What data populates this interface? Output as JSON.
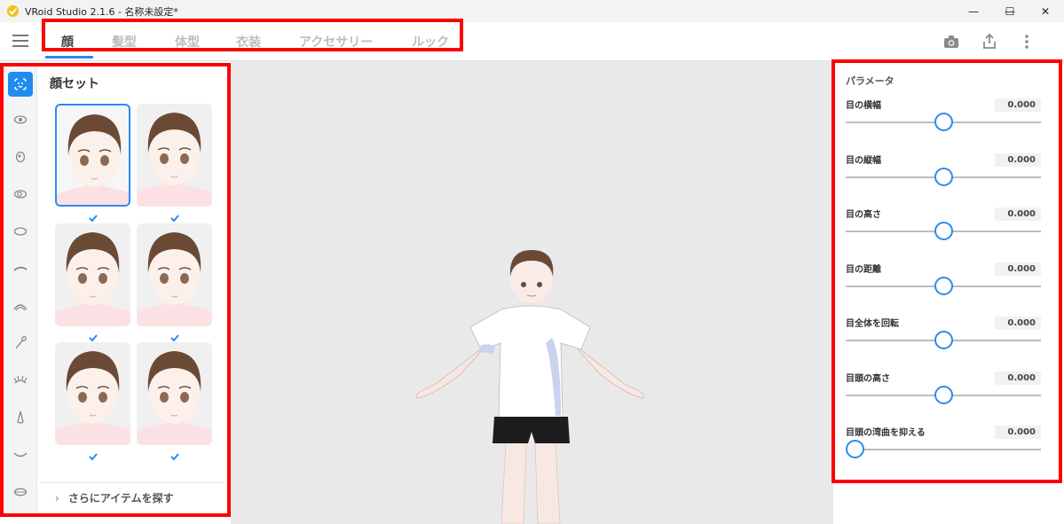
{
  "window": {
    "title": "VRoid Studio 2.1.6 - 名称未設定*",
    "controls": {
      "minimize": "—",
      "maximize": "☐",
      "close": "✕"
    }
  },
  "header": {
    "tabs": [
      {
        "label": "顔",
        "active": true
      },
      {
        "label": "髪型",
        "active": false
      },
      {
        "label": "体型",
        "active": false
      },
      {
        "label": "衣装",
        "active": false
      },
      {
        "label": "アクセサリー",
        "active": false
      },
      {
        "label": "ルック",
        "active": false
      }
    ],
    "icons": [
      "camera-icon",
      "share-icon",
      "more-vertical-icon"
    ]
  },
  "left_panel": {
    "rail_icons": [
      "face-icon",
      "eye-icon",
      "iris-icon",
      "eye-outline-icon",
      "eye-white-icon",
      "eyebrow-icon",
      "eyelid-icon",
      "eyeshadow-brush-icon",
      "eyelash-icon",
      "nose-icon",
      "mouth-icon",
      "ear-icon"
    ],
    "set_title": "顔セット",
    "items": [
      {
        "name": "face-1",
        "selected": true,
        "checked": true
      },
      {
        "name": "face-2",
        "selected": false,
        "checked": true
      },
      {
        "name": "face-3",
        "selected": false,
        "checked": true
      },
      {
        "name": "face-4",
        "selected": false,
        "checked": true
      },
      {
        "name": "face-5",
        "selected": false,
        "checked": true
      },
      {
        "name": "face-6",
        "selected": false,
        "checked": true
      }
    ],
    "more_label": "さらにアイテムを探す"
  },
  "right_panel": {
    "title": "パラメータ",
    "params": [
      {
        "label": "目の横幅",
        "value": "0.000",
        "level": 0.5
      },
      {
        "label": "目の縦幅",
        "value": "0.000",
        "level": 0.5
      },
      {
        "label": "目の高さ",
        "value": "0.000",
        "level": 0.5
      },
      {
        "label": "目の距離",
        "value": "0.000",
        "level": 0.5
      },
      {
        "label": "目全体を回転",
        "value": "0.000",
        "level": 0.5
      },
      {
        "label": "目頭の高さ",
        "value": "0.000",
        "level": 0.5
      },
      {
        "label": "目頭の湾曲を抑える",
        "value": "0.000",
        "level": 0.0
      }
    ]
  },
  "colors": {
    "accent": "#2a8bf2",
    "highlight_box": "#ff0000",
    "viewport_bg": "#e9e9e9"
  }
}
